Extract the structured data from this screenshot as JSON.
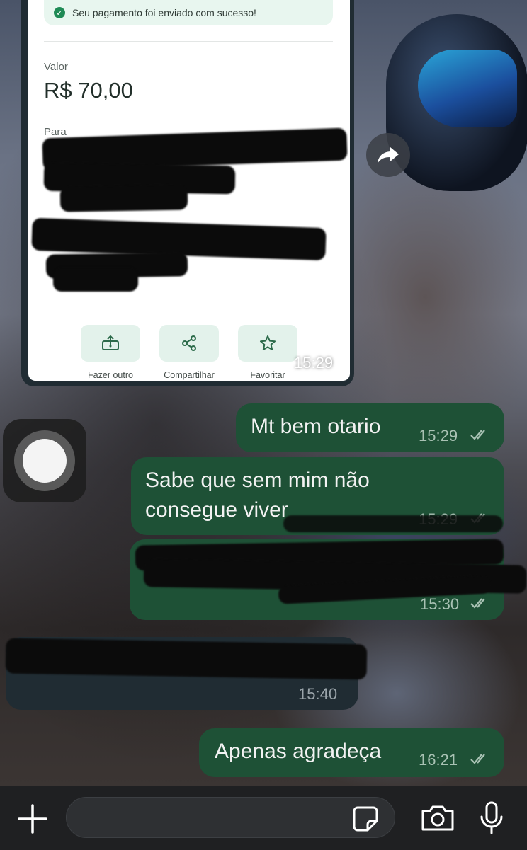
{
  "receipt": {
    "success_text": "Seu pagamento foi enviado com sucesso!",
    "amount_label": "Valor",
    "amount": "R$ 70,00",
    "to_label": "Para",
    "actions": [
      {
        "label": "Fazer outro",
        "icon": "receipt-share-icon"
      },
      {
        "label": "Compartilhar",
        "icon": "share-icon"
      },
      {
        "label": "Favoritar",
        "icon": "star-icon"
      }
    ],
    "time": "15:29"
  },
  "messages": [
    {
      "text": "Mt bem otario",
      "time": "15:29",
      "direction": "outgoing",
      "status": "read"
    },
    {
      "text_line1": "Sabe que sem mim não",
      "text_line2": "consegue viver",
      "time": "15:29",
      "direction": "outgoing",
      "status": "read"
    },
    {
      "text": "",
      "time": "15:30",
      "direction": "outgoing",
      "status": "read",
      "redacted": true
    },
    {
      "text": "",
      "time": "15:40",
      "direction": "incoming",
      "redacted": true
    },
    {
      "text": "Apenas agradeça",
      "time": "16:21",
      "direction": "outgoing",
      "status": "read"
    }
  ],
  "composer": {
    "input_value": "",
    "icons": [
      "plus-icon",
      "sticker-icon",
      "camera-icon",
      "microphone-icon"
    ]
  },
  "colors": {
    "outgoing_bubble": "#1e5136",
    "incoming_bubble": "#202c33",
    "tick_read": "#a9c2b4"
  }
}
